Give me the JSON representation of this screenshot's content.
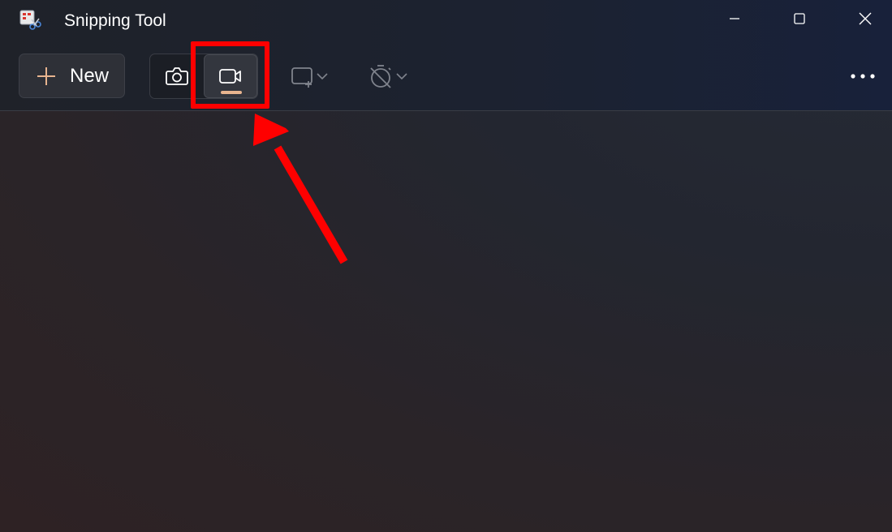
{
  "window": {
    "title": "Snipping Tool"
  },
  "titlebar": {
    "icons": [
      "snipping-tool-app-icon",
      "minimize-icon",
      "maximize-icon",
      "close-icon"
    ]
  },
  "toolbar": {
    "new_label": "New",
    "modes": [
      {
        "icon": "camera-icon",
        "selected": false
      },
      {
        "icon": "video-camera-icon",
        "selected": true
      }
    ],
    "shape_icon": "rectangle-snip-icon",
    "timer_icon": "no-delay-timer-icon",
    "more_icon": "more-options-icon"
  },
  "annotation": {
    "highlight_color": "#ff0000",
    "arrow_color": "#ff0000"
  },
  "colors": {
    "accent_indicator": "#e8b48f",
    "text": "#ffffff"
  }
}
